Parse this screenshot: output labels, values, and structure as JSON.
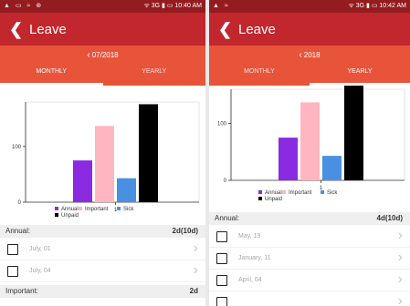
{
  "left": {
    "status": {
      "icons": "▲ ▭ ≈ ⊚",
      "right": "ᯤ 3G ▮ ▭ 10:40 AM"
    },
    "header": {
      "back_icon": "chevron-left-icon",
      "title": "Leave"
    },
    "date_nav": {
      "chevron": "‹",
      "label": "07/2018"
    },
    "tabs": {
      "monthly": "MONTHLY",
      "yearly": "YEARLY",
      "active": "monthly"
    },
    "chart_data": {
      "type": "bar",
      "categories": [
        "1"
      ],
      "series": [
        {
          "name": "Annual",
          "values": [
            75
          ],
          "color": "#8a2be2"
        },
        {
          "name": "Important",
          "values": [
            137
          ],
          "color": "#ffb6c1"
        },
        {
          "name": "Sick",
          "values": [
            43
          ],
          "color": "#4a90e2"
        },
        {
          "name": "Unpaid",
          "values": [
            176
          ],
          "color": "#000000"
        }
      ],
      "y_ticks": [
        "0",
        "100"
      ],
      "ylim": [
        0,
        180
      ],
      "legend_placement": "bottom"
    },
    "sections": [
      {
        "label": "Annual:",
        "value": "2d(10d)",
        "rows": [
          "July, 01",
          "July, 04"
        ]
      },
      {
        "label": "Important:",
        "value": "2d",
        "rows": []
      }
    ]
  },
  "right": {
    "status": {
      "icons": "▲ ≈",
      "right": "ᯤ 3G ▮ ▭ 10:42 AM"
    },
    "header": {
      "back_icon": "chevron-left-icon",
      "title": "Leave"
    },
    "date_nav": {
      "chevron": "‹",
      "label": "2018"
    },
    "tabs": {
      "monthly": "MONTHLY",
      "yearly": "YEARLY",
      "active": "yearly"
    },
    "chart_data": {
      "type": "bar",
      "categories": [
        "1"
      ],
      "series": [
        {
          "name": "Annual",
          "values": [
            75
          ],
          "color": "#8a2be2"
        },
        {
          "name": "Important",
          "values": [
            137
          ],
          "color": "#ffb6c1"
        },
        {
          "name": "Sick",
          "values": [
            43
          ],
          "color": "#4a90e2"
        },
        {
          "name": "Unpaid",
          "values": [
            176
          ],
          "color": "#000000"
        }
      ],
      "y_ticks": [
        "0",
        "100"
      ],
      "ylim": [
        0,
        160
      ],
      "legend_placement": "bottom"
    },
    "sections": [
      {
        "label": "Annual:",
        "value": "4d(10d)",
        "rows": [
          "May, 19",
          "January, 11",
          "April, 04",
          ""
        ]
      }
    ]
  }
}
